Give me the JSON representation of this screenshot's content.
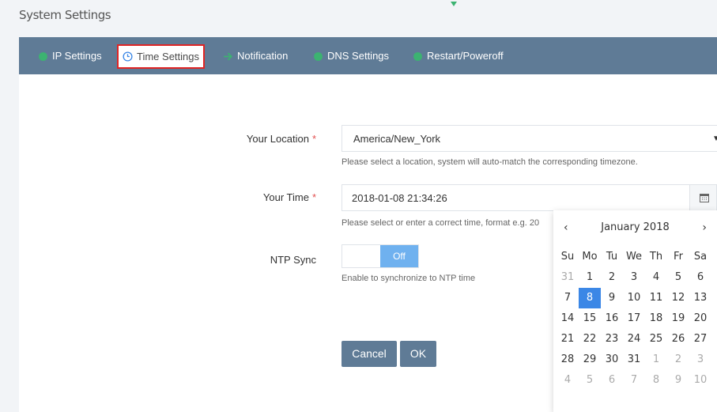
{
  "page": {
    "title": "System Settings"
  },
  "tabs": [
    {
      "label": "IP Settings",
      "icon": "plug-icon",
      "active": false
    },
    {
      "label": "Time Settings",
      "icon": "clock-icon",
      "active": true
    },
    {
      "label": "Notification",
      "icon": "arrow-icon",
      "active": false
    },
    {
      "label": "DNS Settings",
      "icon": "globe-icon",
      "active": false
    },
    {
      "label": "Restart/Poweroff",
      "icon": "power-icon",
      "active": false
    }
  ],
  "form": {
    "location": {
      "label": "Your Location",
      "required_mark": "*",
      "value": "America/New_York",
      "hint": "Please select a location, system will auto-match the corresponding timezone."
    },
    "time": {
      "label": "Your Time",
      "required_mark": "*",
      "value": "2018-01-08 21:34:26",
      "hint": "Please select or enter a correct time, format e.g. 20"
    },
    "ntp": {
      "label": "NTP Sync",
      "toggle_label": "Off",
      "hint": "Enable to synchronize to NTP time"
    },
    "buttons": {
      "cancel": "Cancel",
      "ok": "OK"
    }
  },
  "calendar": {
    "prev": "‹",
    "next": "›",
    "month_title": "January 2018",
    "weekdays": [
      "Su",
      "Mo",
      "Tu",
      "We",
      "Th",
      "Fr",
      "Sa"
    ],
    "weeks": [
      [
        "31",
        "1",
        "2",
        "3",
        "4",
        "5",
        "6"
      ],
      [
        "7",
        "8",
        "9",
        "10",
        "11",
        "12",
        "13"
      ],
      [
        "14",
        "15",
        "16",
        "17",
        "18",
        "19",
        "20"
      ],
      [
        "21",
        "22",
        "23",
        "24",
        "25",
        "26",
        "27"
      ],
      [
        "28",
        "29",
        "30",
        "31",
        "1",
        "2",
        "3"
      ],
      [
        "4",
        "5",
        "6",
        "7",
        "8",
        "9",
        "10"
      ]
    ],
    "selected_day": "8"
  },
  "colors": {
    "tabbar": "#5f7b96",
    "accent_green": "#3cb371",
    "selected_day": "#3b87e6",
    "toggle_off": "#6fb1ef",
    "active_tab_border": "#e02424"
  }
}
